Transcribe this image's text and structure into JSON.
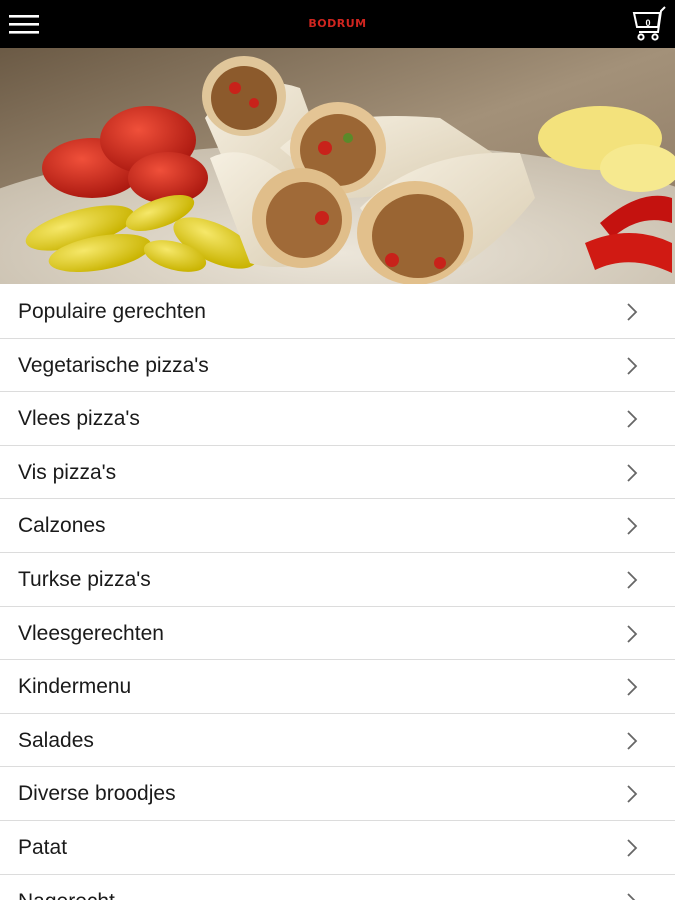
{
  "header": {
    "brand": "BODRUM",
    "menu_icon": "hamburger-menu-icon",
    "cart_icon": "shopping-cart-icon",
    "cart_count": "0",
    "brand_color": "#d0251f",
    "bar_color": "#000000"
  },
  "hero": {
    "image": "wraps-banner-image"
  },
  "categories": [
    {
      "label": "Populaire gerechten"
    },
    {
      "label": "Vegetarische pizza's"
    },
    {
      "label": "Vlees pizza's"
    },
    {
      "label": "Vis pizza's"
    },
    {
      "label": "Calzones"
    },
    {
      "label": "Turkse pizza's"
    },
    {
      "label": "Vleesgerechten"
    },
    {
      "label": "Kindermenu"
    },
    {
      "label": "Salades"
    },
    {
      "label": "Diverse broodjes"
    },
    {
      "label": "Patat"
    },
    {
      "label": "Nagerecht"
    }
  ],
  "chevron_icon": "chevron-right-icon"
}
